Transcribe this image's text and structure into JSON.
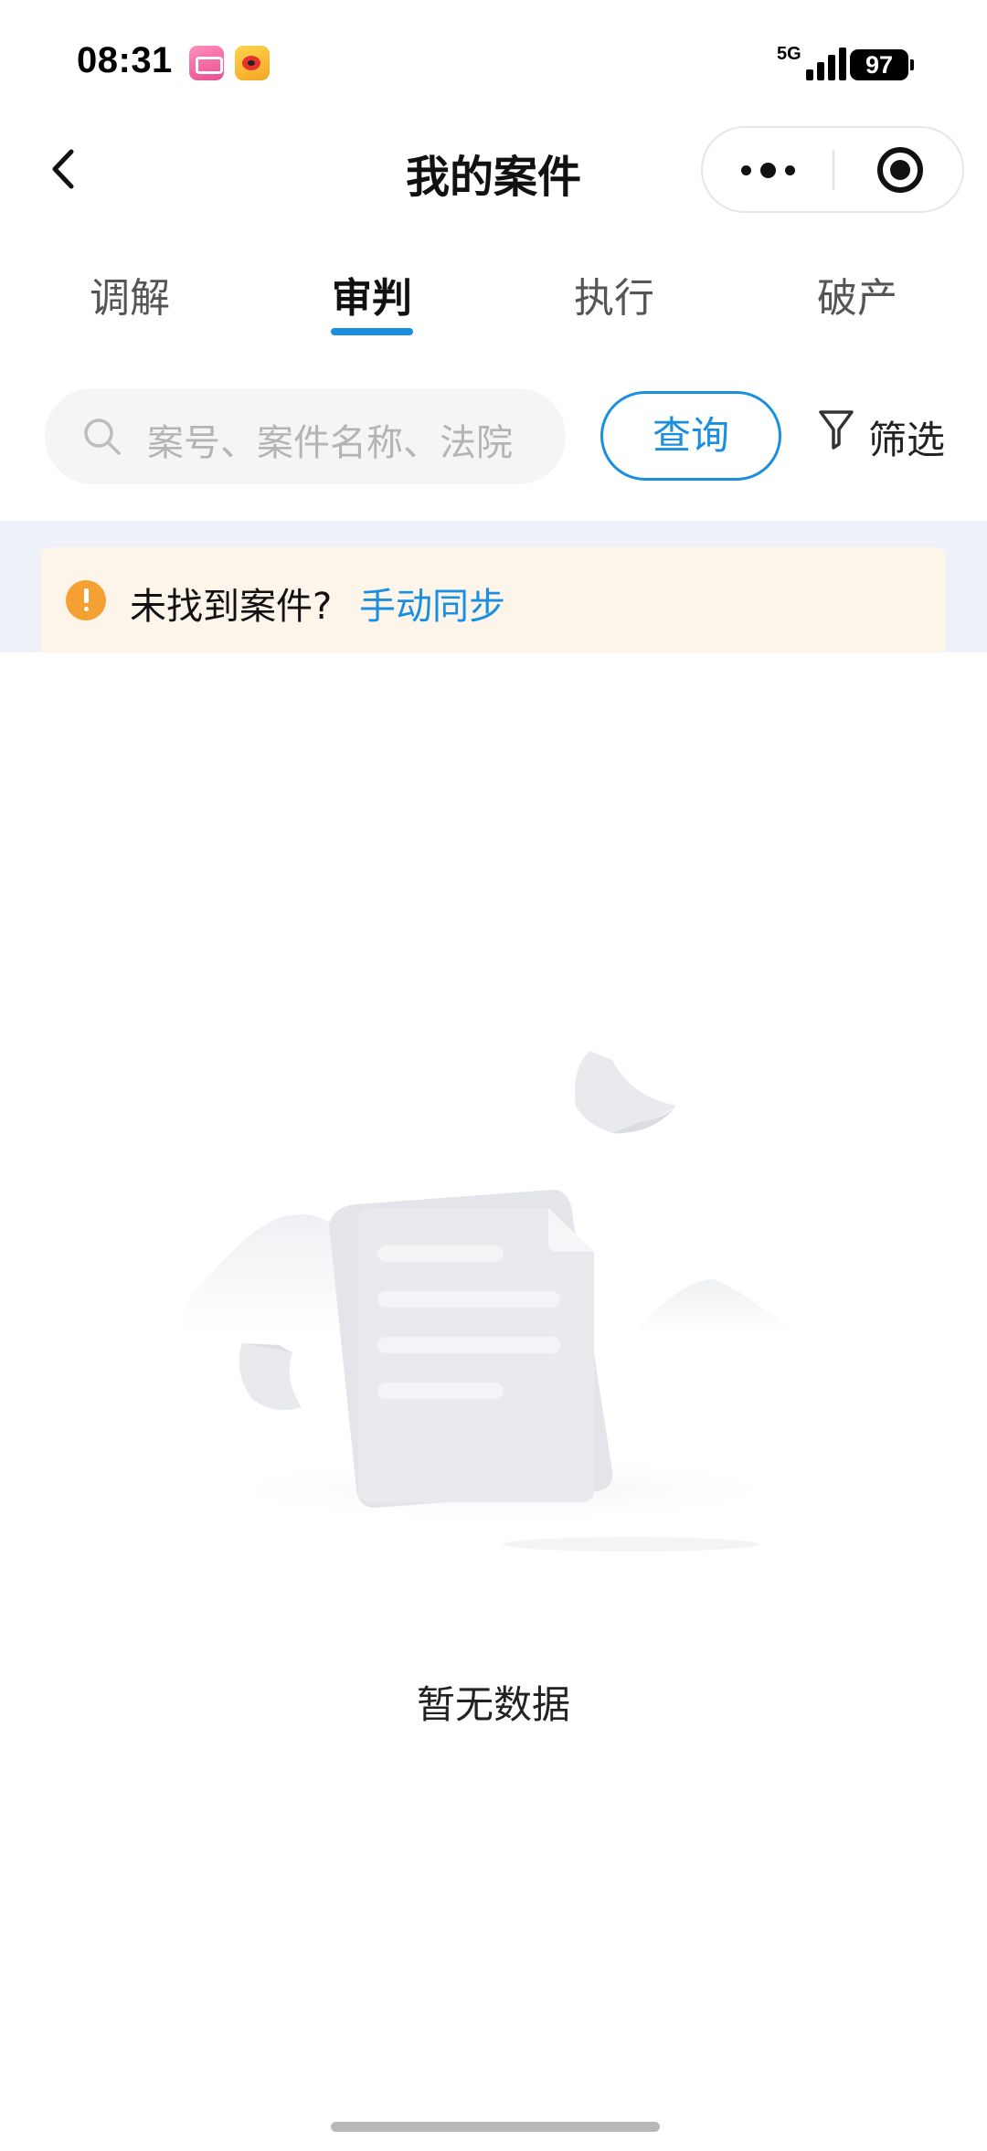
{
  "status_bar": {
    "time": "08:31",
    "network": "5G",
    "battery": "97",
    "app_icons": [
      "bilibili-icon",
      "weibo-icon"
    ]
  },
  "nav": {
    "title": "我的案件",
    "back_icon": "chevron-left-icon",
    "more_icon": "more-dots-icon",
    "close_icon": "target-circle-icon"
  },
  "tabs": {
    "items": [
      {
        "label": "调解"
      },
      {
        "label": "审判"
      },
      {
        "label": "执行"
      },
      {
        "label": "破产"
      }
    ],
    "active_label": "审判"
  },
  "search": {
    "placeholder": "案号、案件名称、法院",
    "query_label": "查询",
    "filter_label": "筛选"
  },
  "notice": {
    "text": "未找到案件?",
    "link_label": "手动同步"
  },
  "empty_state": {
    "message": "暂无数据"
  },
  "colors": {
    "accent": "#1a8fe0",
    "warning": "#f5a033",
    "notice_background": "#fdf4ea",
    "band_background": "#eef2f8"
  }
}
